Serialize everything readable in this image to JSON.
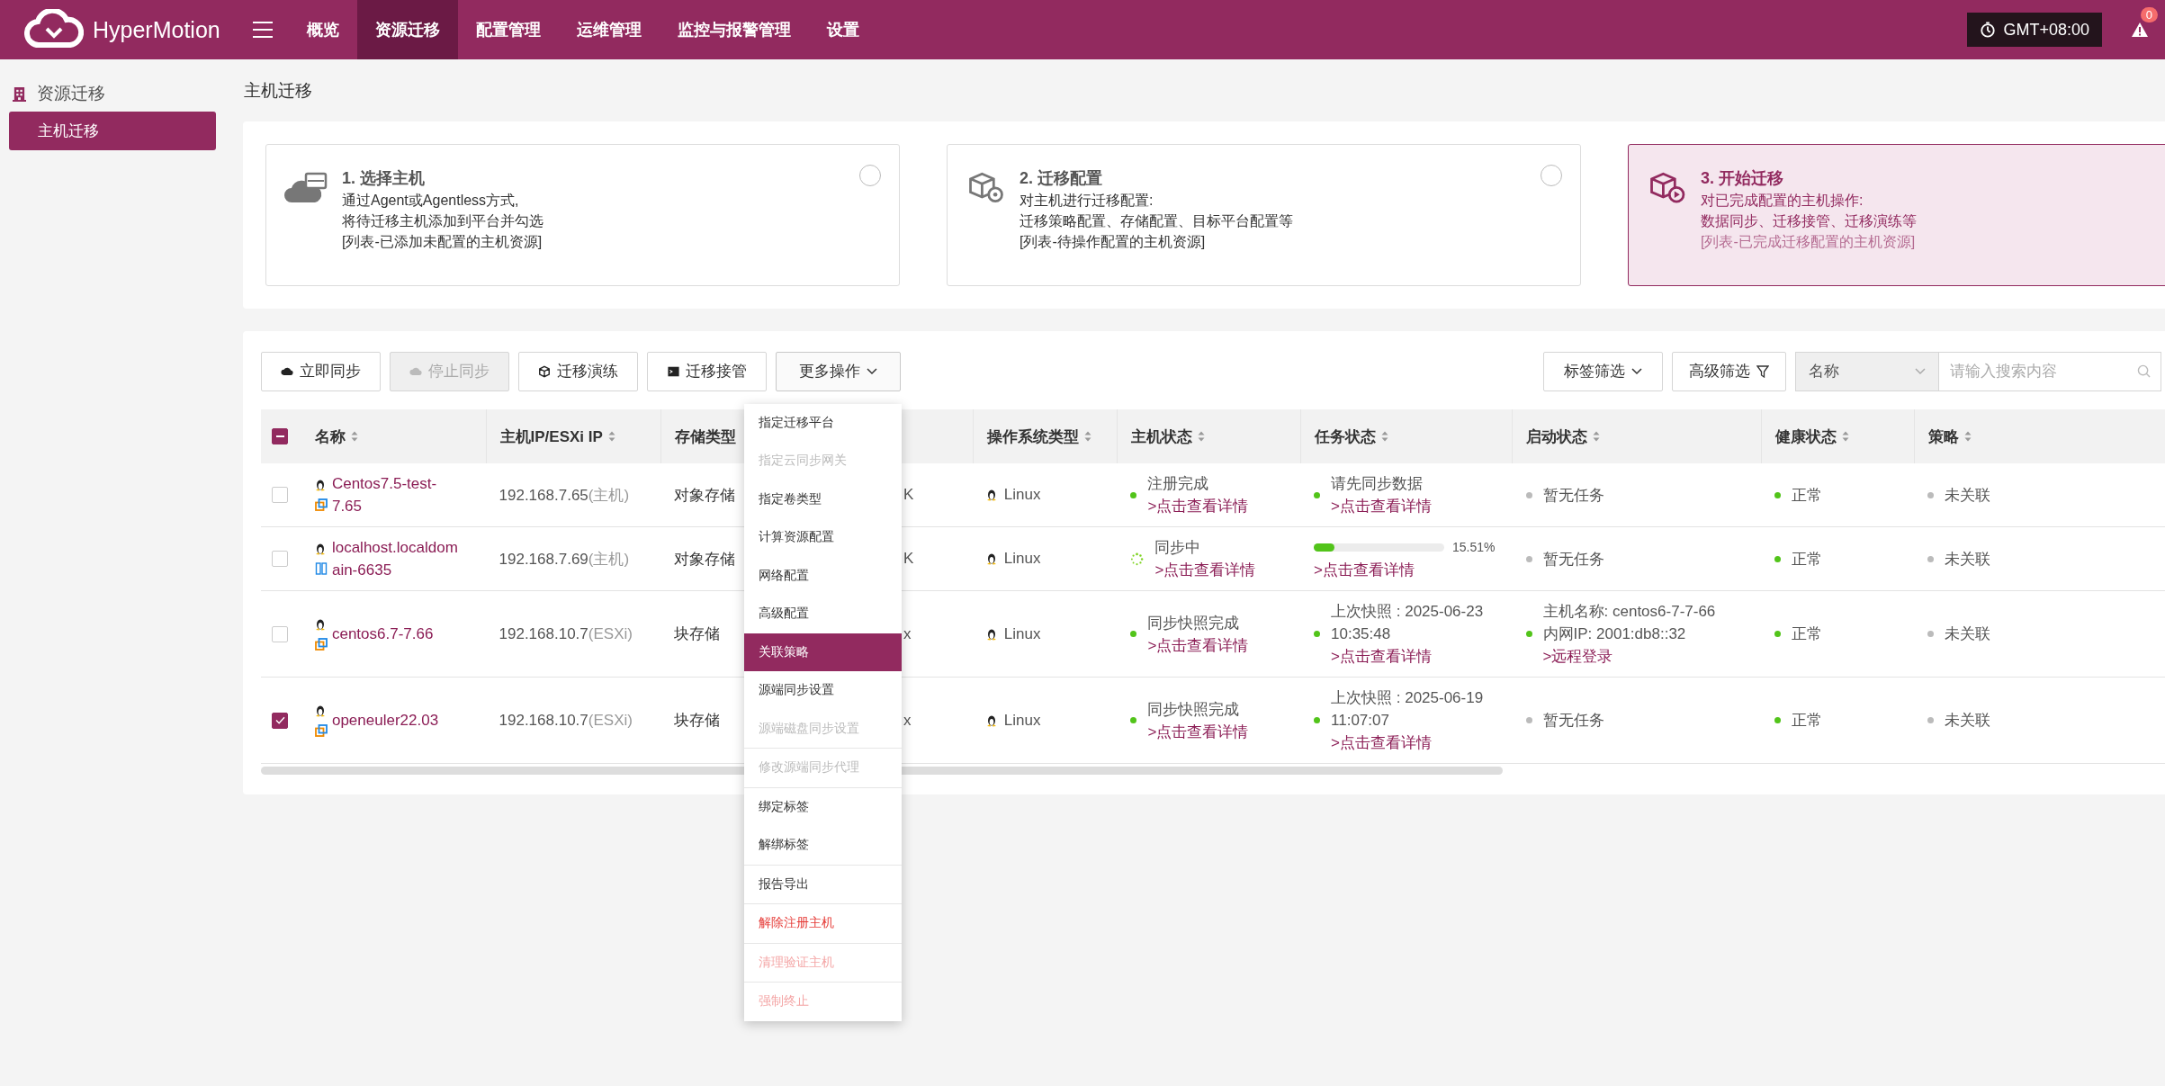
{
  "brand": "HyperMotion",
  "nav": [
    {
      "label": "概览",
      "selected": false
    },
    {
      "label": "资源迁移",
      "selected": true
    },
    {
      "label": "配置管理",
      "selected": false
    },
    {
      "label": "运维管理",
      "selected": false
    },
    {
      "label": "监控与报警管理",
      "selected": false
    },
    {
      "label": "设置",
      "selected": false
    }
  ],
  "timezone": "GMT+08:00",
  "alert_count": "0",
  "sidebar": {
    "group": "资源迁移",
    "items": [
      {
        "label": "主机迁移",
        "selected": true
      }
    ]
  },
  "page_title": "主机迁移",
  "steps": [
    {
      "kind": "host",
      "title": "1. 选择主机",
      "lines": [
        "通过Agent或Agentless方式,",
        "将待迁移主机添加到平台并勾选"
      ],
      "note": "[列表-已添加未配置的主机资源]",
      "selected": false
    },
    {
      "kind": "config",
      "title": "2. 迁移配置",
      "lines": [
        "对主机进行迁移配置:",
        "迁移策略配置、存储配置、目标平台配置等"
      ],
      "note": "[列表-待操作配置的主机资源]",
      "selected": false
    },
    {
      "kind": "start",
      "title": "3. 开始迁移",
      "lines": [
        "对已完成配置的主机操作:",
        "数据同步、迁移接管、迁移演练等"
      ],
      "note": "[列表-已完成迁移配置的主机资源]",
      "selected": true
    }
  ],
  "toolbar": {
    "buttons": [
      {
        "kind": "sync",
        "label": "立即同步",
        "disabled": false
      },
      {
        "kind": "stop",
        "label": "停止同步",
        "disabled": true
      },
      {
        "kind": "drill",
        "label": "迁移演练",
        "disabled": false
      },
      {
        "kind": "takeover",
        "label": "迁移接管",
        "disabled": false
      }
    ],
    "more": {
      "label": "更多操作",
      "expanded": true
    },
    "tag_filter": "标签筛选",
    "advanced_filter": "高级筛选",
    "search_field": "名称",
    "search_placeholder": "请输入搜索内容"
  },
  "menu_groups": [
    [
      {
        "label": "指定迁移平台",
        "kind": "normal",
        "disabled": false,
        "selected": false
      },
      {
        "label": "指定云同步网关",
        "kind": "normal",
        "disabled": true,
        "selected": false
      },
      {
        "label": "指定卷类型",
        "kind": "normal",
        "disabled": false,
        "selected": false
      },
      {
        "label": "计算资源配置",
        "kind": "normal",
        "disabled": false,
        "selected": false
      },
      {
        "label": "网络配置",
        "kind": "normal",
        "disabled": false,
        "selected": false
      },
      {
        "label": "高级配置",
        "kind": "normal",
        "disabled": false,
        "selected": false
      },
      {
        "label": "关联策略",
        "kind": "normal",
        "disabled": false,
        "selected": true
      },
      {
        "label": "源端同步设置",
        "kind": "normal",
        "disabled": false,
        "selected": false
      },
      {
        "label": "源端磁盘同步设置",
        "kind": "normal",
        "disabled": true,
        "selected": false
      }
    ],
    [
      {
        "label": "修改源端同步代理",
        "kind": "normal",
        "disabled": true,
        "selected": false
      }
    ],
    [
      {
        "label": "绑定标签",
        "kind": "normal",
        "disabled": false,
        "selected": false
      },
      {
        "label": "解绑标签",
        "kind": "normal",
        "disabled": false,
        "selected": false
      }
    ],
    [
      {
        "label": "报告导出",
        "kind": "normal",
        "disabled": false,
        "selected": false
      }
    ],
    [
      {
        "label": "解除注册主机",
        "kind": "danger",
        "disabled": false,
        "selected": false
      }
    ],
    [
      {
        "label": "清理验证主机",
        "kind": "danger",
        "disabled": true,
        "selected": false
      }
    ],
    [
      {
        "label": "强制终止",
        "kind": "danger",
        "disabled": true,
        "selected": false
      }
    ]
  ],
  "table": {
    "header_indeterminate": true,
    "columns": [
      "名称",
      "主机IP/ESXi IP",
      "存储类型",
      "操作系统类型",
      "主机状态",
      "任务状态",
      "启动状态",
      "健康状态",
      "策略"
    ],
    "rows": [
      {
        "checked": false,
        "name": "Centos7.5-test-7.65",
        "kind": "vm",
        "ip": "192.168.7.65",
        "ip_note": "(主机)",
        "storage": "对象存储",
        "column_4": "K",
        "os": "Linux",
        "host_status": {
          "kind": "dot",
          "color": "#52c41a",
          "text": "注册完成",
          "link": ">点击查看详情"
        },
        "task": {
          "kind": "dot",
          "color": "#52c41a",
          "lines": [
            "请先同步数据"
          ],
          "link": ">点击查看详情"
        },
        "start": {
          "color": "#bbbbbb",
          "lines": [
            "暂无任务"
          ]
        },
        "health": {
          "color": "#52c41a",
          "text": "正常"
        },
        "policy": {
          "color": "#bbbbbb",
          "text": "未关联"
        }
      },
      {
        "checked": false,
        "name": "localhost.localdomain-6635",
        "kind": "host",
        "ip": "192.168.7.69",
        "ip_note": "(主机)",
        "storage": "对象存储",
        "column_4": "K",
        "os": "Linux",
        "host_status": {
          "kind": "spinner",
          "text": "同步中",
          "link": ">点击查看详情"
        },
        "task": {
          "kind": "progress",
          "level": 0.1551,
          "reading": "15.51%",
          "link": ">点击查看详情"
        },
        "start": {
          "color": "#bbbbbb",
          "lines": [
            "暂无任务"
          ]
        },
        "health": {
          "color": "#52c41a",
          "text": "正常"
        },
        "policy": {
          "color": "#bbbbbb",
          "text": "未关联"
        }
      },
      {
        "checked": false,
        "name": "centos6.7-7.66",
        "kind": "vm",
        "ip": "192.168.10.7",
        "ip_note": "(ESXi)",
        "storage": "块存储",
        "column_4": "x",
        "os": "Linux",
        "host_status": {
          "kind": "dot",
          "color": "#52c41a",
          "text": "同步快照完成",
          "link": ">点击查看详情"
        },
        "task": {
          "kind": "dot",
          "color": "#52c41a",
          "lines": [
            "上次快照 : 2025-06-23 10:35:48"
          ],
          "link": ">点击查看详情"
        },
        "start": {
          "color": "#52c41a",
          "lines": [
            "主机名称: centos6-7-7-66",
            "内网IP: 2001:db8::32"
          ],
          "link": ">远程登录"
        },
        "health": {
          "color": "#52c41a",
          "text": "正常"
        },
        "policy": {
          "color": "#bbbbbb",
          "text": "未关联"
        }
      },
      {
        "checked": true,
        "name": "openeuler22.03",
        "kind": "vm",
        "ip": "192.168.10.7",
        "ip_note": "(ESXi)",
        "storage": "块存储",
        "column_4": "x",
        "os": "Linux",
        "host_status": {
          "kind": "dot",
          "color": "#52c41a",
          "text": "同步快照完成",
          "link": ">点击查看详情"
        },
        "task": {
          "kind": "dot",
          "color": "#52c41a",
          "lines": [
            "上次快照 : 2025-06-19 11:07:07"
          ],
          "link": ">点击查看详情"
        },
        "start": {
          "color": "#bbbbbb",
          "lines": [
            "暂无任务"
          ]
        },
        "health": {
          "color": "#52c41a",
          "text": "正常"
        },
        "policy": {
          "color": "#bbbbbb",
          "text": "未关联"
        }
      }
    ]
  }
}
